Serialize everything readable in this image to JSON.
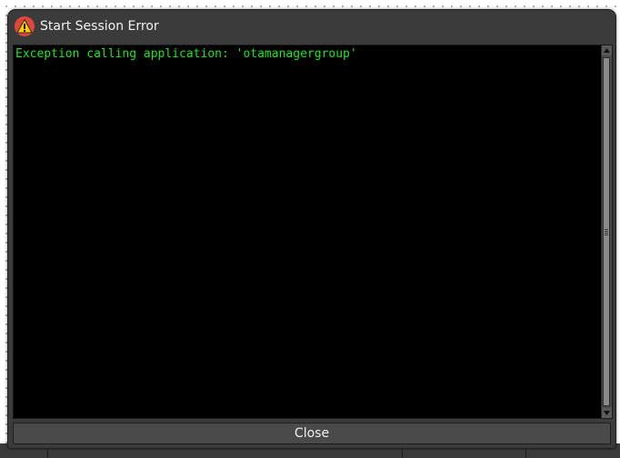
{
  "dialog": {
    "title": "Start Session Error",
    "title_icon": "warning-icon",
    "console_text": "Exception calling application: 'otamanagergroup'",
    "close_label": "Close"
  },
  "colors": {
    "console_text": "#1fe51f",
    "console_bg": "#000000",
    "dialog_bg": "#3b3b3b",
    "warning_badge": "#e0473b",
    "warning_triangle": "#ffcc00"
  }
}
